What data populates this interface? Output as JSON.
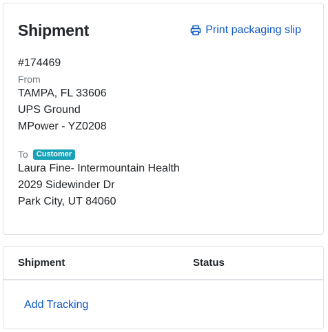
{
  "shipment_card": {
    "title": "Shipment",
    "print_label": "Print packaging slip",
    "order_number": "#174469",
    "from_label": "From",
    "from_lines": [
      "TAMPA, FL 33606",
      "UPS Ground",
      "MPower - YZ0208"
    ],
    "to_label": "To",
    "to_badge": "Customer",
    "to_lines": [
      "Laura Fine- Intermountain Health",
      "2029 Sidewinder Dr",
      "Park City, UT 84060"
    ]
  },
  "table": {
    "headers": [
      "Shipment",
      "Status"
    ],
    "add_tracking_label": "Add Tracking"
  },
  "colors": {
    "link": "#0b57c4",
    "badge": "#17a2b8",
    "border": "#dfe1e5"
  },
  "icons": {
    "print": "printer-icon"
  }
}
